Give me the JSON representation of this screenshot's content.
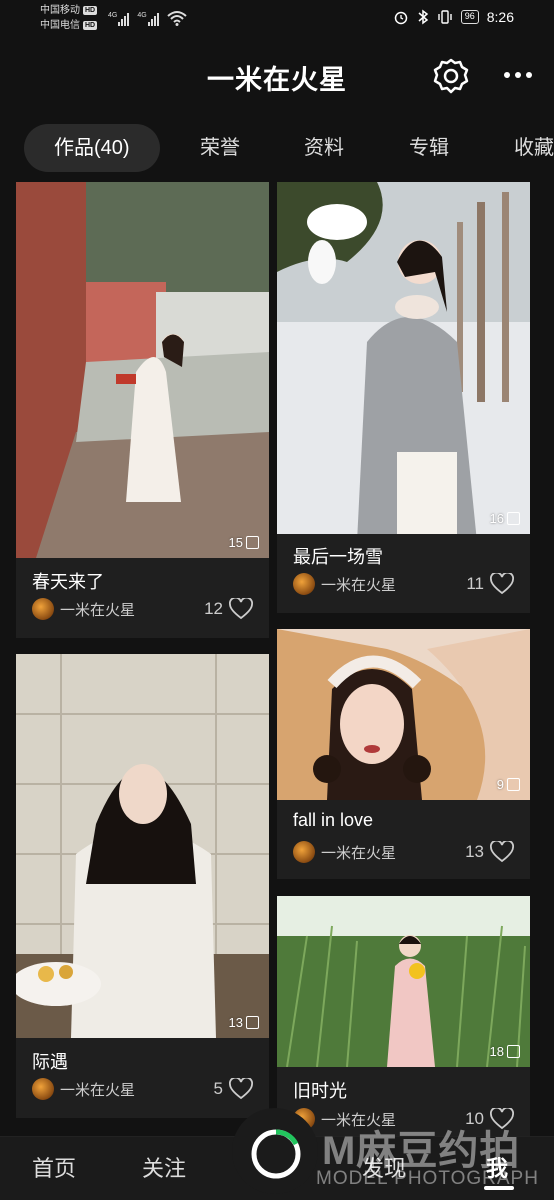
{
  "status_bar": {
    "carrier1": "中国移动",
    "carrier2": "中国电信",
    "hd": "HD",
    "net1": "4G",
    "net2": "4G",
    "battery": "96",
    "time": "8:26"
  },
  "header": {
    "title": "一米在火星"
  },
  "tabs": [
    {
      "label": "作品(40)"
    },
    {
      "label": "荣誉"
    },
    {
      "label": "资料"
    },
    {
      "label": "专辑"
    },
    {
      "label": "收藏"
    }
  ],
  "works": [
    {
      "title": "春天来了",
      "photo_count": "15",
      "author": "一米在火星",
      "likes": "12"
    },
    {
      "title": "最后一场雪",
      "photo_count": "16",
      "author": "一米在火星",
      "likes": "11"
    },
    {
      "title": "际遇",
      "photo_count": "13",
      "author": "一米在火星",
      "likes": "5"
    },
    {
      "title": "fall in love",
      "photo_count": "9",
      "author": "一米在火星",
      "likes": "13"
    },
    {
      "title": "旧时光",
      "photo_count": "18",
      "author": "一米在火星",
      "likes": "10"
    }
  ],
  "bottom_nav": [
    {
      "label": "首页"
    },
    {
      "label": "关注"
    },
    {
      "label": "发现"
    },
    {
      "label": "我"
    }
  ],
  "watermark": {
    "main": "M麻豆约拍",
    "sub": "MODEL PHOTOGRAPH"
  },
  "colors": {
    "background": "#121212",
    "card": "#1f1f1f",
    "tab_active": "#2b2b2b",
    "ring_accent": "#22c55e"
  }
}
